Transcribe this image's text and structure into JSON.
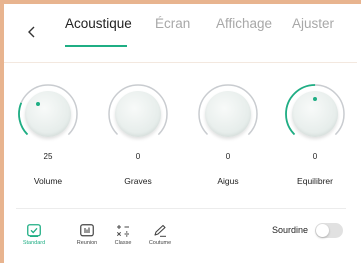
{
  "header": {
    "tabs": [
      {
        "label": "Acoustique",
        "active": true
      },
      {
        "label": "Écran",
        "active": false
      },
      {
        "label": "Affichage",
        "active": false
      },
      {
        "label": "Ajuster",
        "active": false
      }
    ]
  },
  "knobs": [
    {
      "label": "Volume",
      "value": "25"
    },
    {
      "label": "Graves",
      "value": "0"
    },
    {
      "label": "Aigus",
      "value": "0"
    },
    {
      "label": "Equilibrer",
      "value": "0"
    }
  ],
  "modes": [
    {
      "label": "Standard",
      "icon": "check-icon",
      "active": true
    },
    {
      "label": "Reunion",
      "icon": "bars-icon",
      "active": false
    },
    {
      "label": "Classe",
      "icon": "math-icon",
      "active": false
    },
    {
      "label": "Coutume",
      "icon": "pen-icon",
      "active": false
    }
  ],
  "mute": {
    "label": "Sourdine",
    "enabled": false
  },
  "colors": {
    "accent": "#1fae84",
    "frame": "#e8b48f"
  }
}
